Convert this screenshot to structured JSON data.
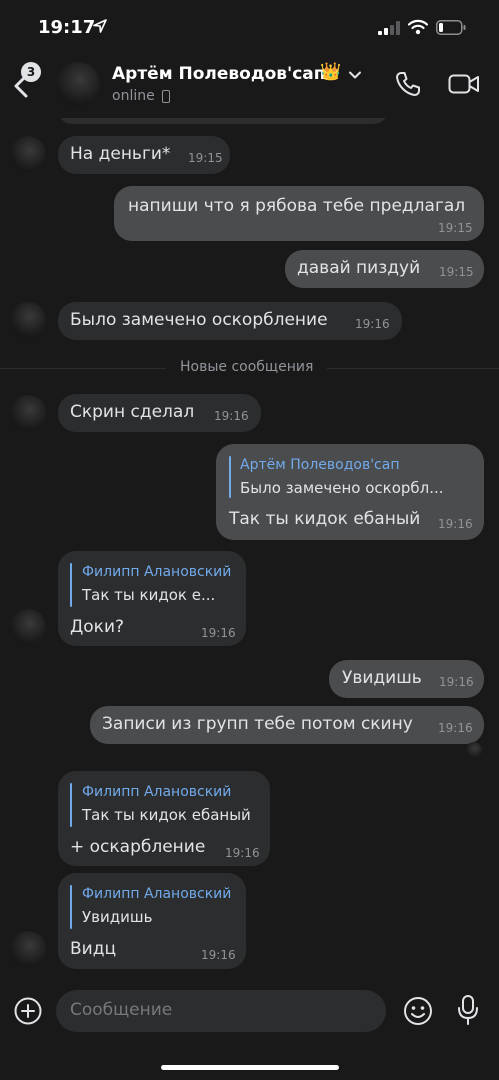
{
  "status_bar": {
    "time": "19:17"
  },
  "header": {
    "unread_count": "3",
    "contact_name": "Артём Полеводов'сап",
    "crown": "👑",
    "status": "online"
  },
  "divider": {
    "label": "Новые сообщения"
  },
  "messages": [
    {
      "direction": "in",
      "text": "На деньги*",
      "time": "19:15"
    },
    {
      "direction": "out",
      "text": "напиши что я рябова тебе предлагал",
      "time": "19:15"
    },
    {
      "direction": "out",
      "text": "давай пиздуй",
      "time": "19:15"
    },
    {
      "direction": "in",
      "text": "Было замечено оскорбление",
      "time": "19:16"
    },
    {
      "direction": "in",
      "text": "Скрин сделал",
      "time": "19:16"
    },
    {
      "direction": "out",
      "reply_author": "Артём Полеводов'сап",
      "reply_text": "Было замечено оскорбл...",
      "text": "Так ты кидок ебаный",
      "time": "19:16"
    },
    {
      "direction": "in",
      "reply_author": "Филипп Алановский",
      "reply_text": "Так ты кидок е...",
      "text": "Доки?",
      "time": "19:16"
    },
    {
      "direction": "out",
      "text": "Увидишь",
      "time": "19:16"
    },
    {
      "direction": "out",
      "text": "Записи из групп тебе потом скину",
      "time": "19:16"
    },
    {
      "direction": "in",
      "reply_author": "Филипп Алановский",
      "reply_text": "Так ты кидок ебаный",
      "text": "+ оскарбление",
      "time": "19:16"
    },
    {
      "direction": "in",
      "reply_author": "Филипп Алановский",
      "reply_text": "Увидишь",
      "text": "Видц",
      "time": "19:16"
    }
  ],
  "composer": {
    "placeholder": "Сообщение"
  },
  "colors": {
    "background": "#19191a",
    "incoming": "#2c2d2e",
    "outgoing": "#4b4c4e",
    "accent": "#71aaeb"
  }
}
